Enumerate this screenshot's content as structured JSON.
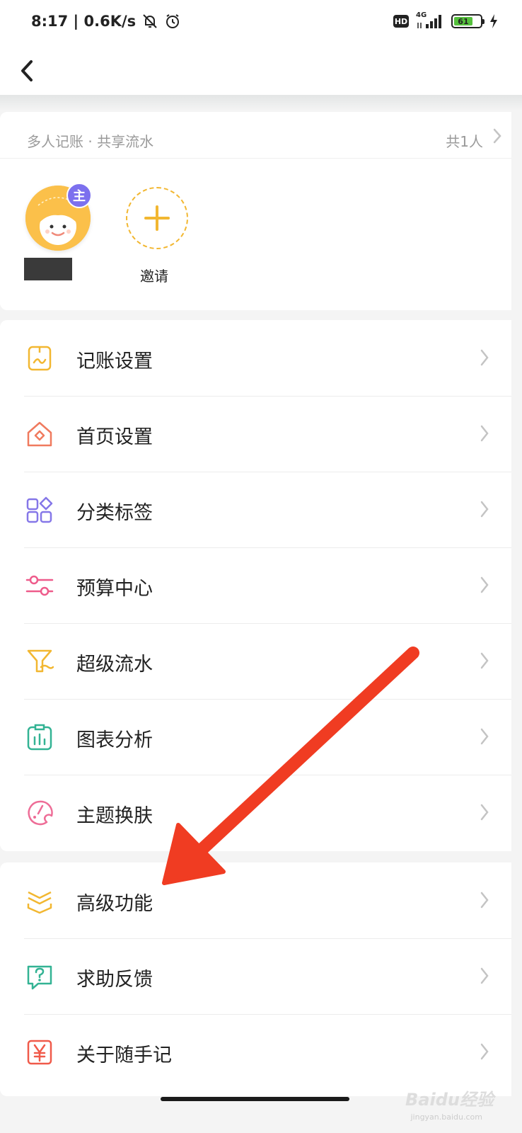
{
  "status_bar": {
    "time_speed": "8:17 | 0.6K/s",
    "hd": "HD",
    "network": "4G",
    "battery": "61"
  },
  "share": {
    "title": "多人记账 · 共享流水",
    "count": "共1人",
    "owner_badge": "主",
    "invite_label": "邀请"
  },
  "menu_group_1": [
    {
      "label": "记账设置",
      "icon": "bookkeeping-settings-icon"
    },
    {
      "label": "首页设置",
      "icon": "home-settings-icon"
    },
    {
      "label": "分类标签",
      "icon": "category-tags-icon"
    },
    {
      "label": "预算中心",
      "icon": "budget-sliders-icon"
    },
    {
      "label": "超级流水",
      "icon": "super-flow-icon"
    },
    {
      "label": "图表分析",
      "icon": "chart-analysis-icon"
    },
    {
      "label": "主题换肤",
      "icon": "theme-palette-icon"
    }
  ],
  "menu_group_2": [
    {
      "label": "高级功能",
      "icon": "advanced-features-icon"
    },
    {
      "label": "求助反馈",
      "icon": "help-feedback-icon"
    },
    {
      "label": "关于随手记",
      "icon": "about-yen-icon"
    }
  ],
  "watermark": {
    "brand": "Baidu经验",
    "url": "jingyan.baidu.com"
  },
  "colors": {
    "accent_yellow": "#f2b731",
    "owner_badge": "#7c70ee",
    "annotation_arrow": "#f03c22"
  }
}
